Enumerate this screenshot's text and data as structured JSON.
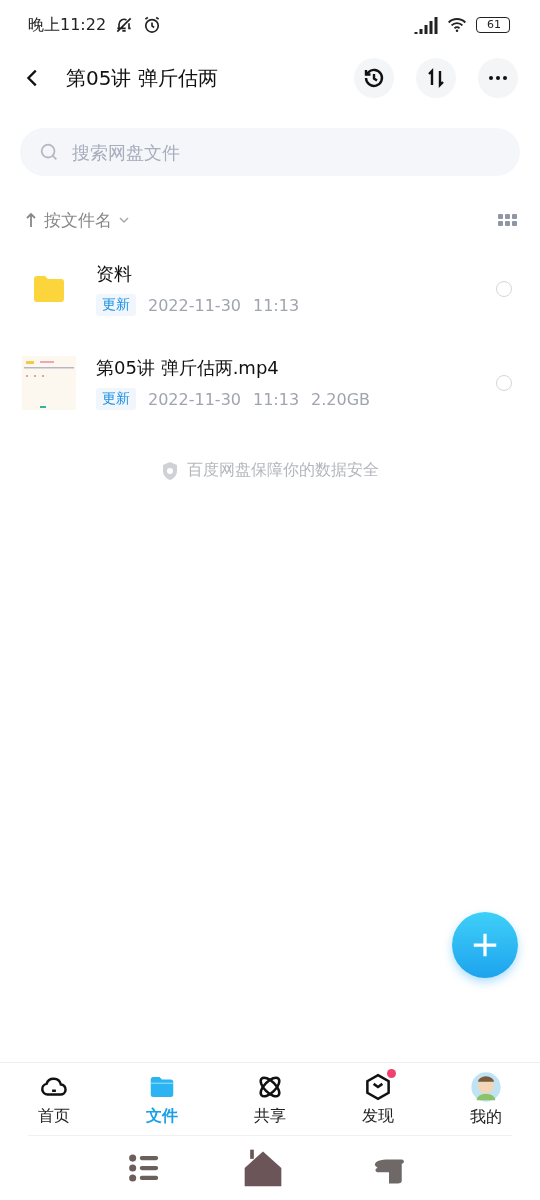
{
  "status_bar": {
    "time": "晚上11:22",
    "battery": "61"
  },
  "header": {
    "title": "第05讲 弹斤估两"
  },
  "search": {
    "placeholder": "搜索网盘文件"
  },
  "sort": {
    "label": "按文件名"
  },
  "files": [
    {
      "kind": "folder",
      "name": "资料",
      "tag": "更新",
      "date": "2022-11-30",
      "time": "11:13",
      "selected": false
    },
    {
      "kind": "video",
      "name": "第05讲 弹斤估两.mp4",
      "tag": "更新",
      "date": "2022-11-30",
      "time": "11:13",
      "size": "2.20GB",
      "selected": false
    }
  ],
  "footer_note": "百度网盘保障你的数据安全",
  "tabs": [
    {
      "kind": "home",
      "label": "首页",
      "selected": false,
      "badge": false
    },
    {
      "kind": "files",
      "label": "文件",
      "selected": true,
      "badge": false
    },
    {
      "kind": "share",
      "label": "共享",
      "selected": false,
      "badge": false
    },
    {
      "kind": "discover",
      "label": "发现",
      "selected": false,
      "badge": true
    },
    {
      "kind": "me",
      "label": "我的",
      "selected": false,
      "badge": false
    }
  ]
}
